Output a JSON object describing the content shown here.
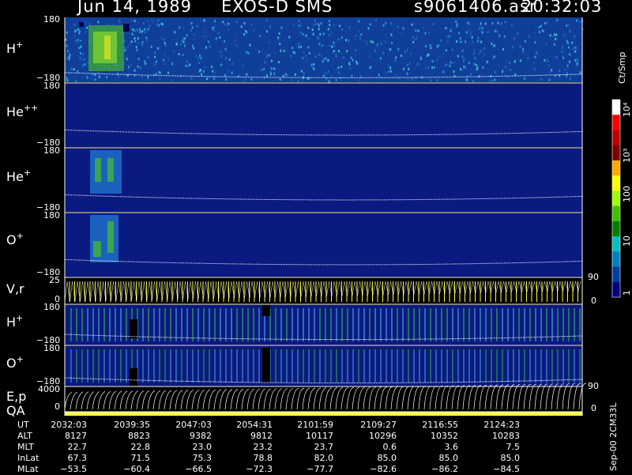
{
  "header": {
    "date": "Jun 14, 1989",
    "mission": "EXOS-D SMS",
    "file": "s9061406.asr",
    "time": "20:32:03"
  },
  "panels": [
    {
      "name": "H",
      "charge": "+",
      "y_top": "180",
      "y_bottom": "−180"
    },
    {
      "name": "He",
      "charge": "++",
      "y_top": "180",
      "y_bottom": "−180"
    },
    {
      "name": "He",
      "charge": "+",
      "y_top": "180",
      "y_bottom": "−180"
    },
    {
      "name": "O",
      "charge": "+",
      "y_top": "180",
      "y_bottom": "−180"
    },
    {
      "name": "V,r",
      "charge": "",
      "y_top": "25",
      "y_bottom": "0",
      "right_top": "90",
      "right_bottom": "0"
    },
    {
      "name": "H",
      "charge": "+",
      "y_top": "180",
      "y_bottom": "−180"
    },
    {
      "name": "O",
      "charge": "+",
      "y_top": "180",
      "y_bottom": "−180"
    },
    {
      "name": "E,p",
      "charge": "",
      "y_top": "4000",
      "y_bottom": "0",
      "right_top": "90",
      "right_bottom": "0"
    }
  ],
  "qa_label": "QA",
  "colorbar": {
    "unit": "Ct/Smp",
    "labels": [
      "10⁴",
      "10³",
      "100",
      "10",
      "1"
    ],
    "colors": [
      "#ffffff",
      "#ff0000",
      "#c00000",
      "#800000",
      "#ffaa00",
      "#ffff00",
      "#a0ff00",
      "#40c000",
      "#008000",
      "#00c0c0",
      "#0080c0",
      "#0040a0",
      "#000080"
    ]
  },
  "chart_data": {
    "type": "heatmap",
    "title": "Jun 14, 1989   EXOS-D SMS",
    "x_ticks_ut": [
      "2032:03",
      "2039:35",
      "2047:03",
      "2054:31",
      "2101:59",
      "2109:27",
      "2116:55",
      "2124:23"
    ],
    "ephemeris": {
      "UT": [
        "2032:03",
        "2039:35",
        "2047:03",
        "2054:31",
        "2101:59",
        "2109:27",
        "2116:55",
        "2124:23"
      ],
      "ALT": [
        "8127",
        "8823",
        "9382",
        "9812",
        "10117",
        "10296",
        "10352",
        "10283"
      ],
      "MLT": [
        "22.7",
        "22.8",
        "23.0",
        "23.2",
        "23.7",
        "0.6",
        "3.6",
        "7.5"
      ],
      "InLat": [
        "67.3",
        "71.5",
        "75.3",
        "78.8",
        "82.0",
        "85.0",
        "85.0",
        "85.0"
      ],
      "MLat": [
        "−53.5",
        "−60.4",
        "−66.5",
        "−72.3",
        "−77.7",
        "−82.6",
        "−86.2",
        "−84.5"
      ]
    },
    "y_range_angle": [
      -180,
      180
    ],
    "colorbar_range": [
      1,
      10000
    ],
    "colorbar_scale": "log"
  },
  "footer_vertical": "Sep-00  2CM33L"
}
